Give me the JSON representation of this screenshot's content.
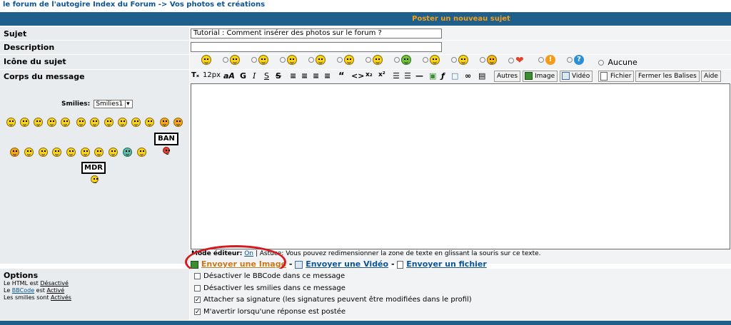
{
  "breadcrumb": {
    "site": "le forum de l'autogire Index du Forum",
    "sep": "->",
    "section": "Vos photos et créations"
  },
  "header": {
    "title": "Poster un nouveau sujet"
  },
  "subject": {
    "label": "Sujet",
    "value": "Tutorial : Comment insérer des photos sur le forum ?"
  },
  "description": {
    "label": "Description",
    "value": ""
  },
  "topic_icon": {
    "label": "Icône du sujet",
    "none_label": "Aucune"
  },
  "body": {
    "label": "Corps du message"
  },
  "smilies": {
    "label": "Smilies:",
    "selected": "Smilies1",
    "ban_sign": "BAN",
    "mdr_sign": "MDR"
  },
  "toolbar": {
    "font_size": "12px",
    "bold": "G",
    "italic": "I",
    "underline": "S",
    "strike": "S",
    "quote": "“",
    "code": "<>",
    "sub": "x₂",
    "sup": "x²",
    "others": "Autres",
    "image": "Image",
    "video": "Vidéo",
    "file": "Fichier",
    "close_tags": "Fermer les Balises",
    "help": "Aide"
  },
  "editor_mode": {
    "label": "Mode éditeur:",
    "value": "On",
    "tip": "Astuce: Vous pouvez redimensionner la zone de texte en glissant la souris sur ce texte."
  },
  "upload_links": {
    "image": "Envoyer une Image",
    "video": "Envoyer une Vidéo",
    "file": "Envoyer un fichier",
    "sep": "-"
  },
  "options": {
    "title": "Options",
    "html_prefix": "Le HTML est",
    "html_state": "Désactivé",
    "bbcode_prefix": "Le",
    "bbcode_link": "BBCode",
    "bbcode_mid": "est",
    "bbcode_state": "Activé",
    "smilies_prefix": "Les smilies sont",
    "smilies_state": "Activés",
    "items": [
      {
        "label": "Désactiver le BBCode dans ce message",
        "checked": false
      },
      {
        "label": "Désactiver les smilies dans ce message",
        "checked": false
      },
      {
        "label": "Attacher sa signature (les signatures peuvent être modifiées dans le profil)",
        "checked": true
      },
      {
        "label": "M'avertir lorsqu'une réponse est postée",
        "checked": true
      }
    ]
  },
  "colors": {
    "header_bg": "#1f5f8b",
    "header_text": "#f0a01a",
    "link": "#0b5394",
    "highlight_circle": "#d8191f"
  }
}
